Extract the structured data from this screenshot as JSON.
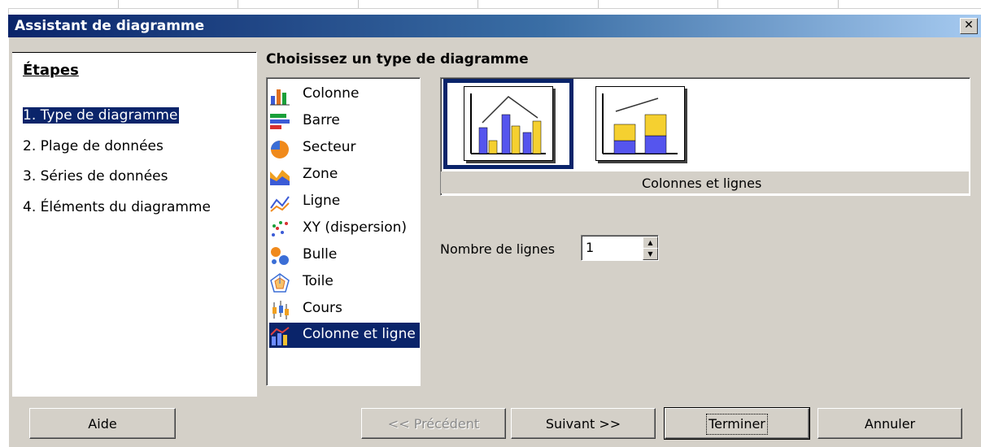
{
  "dialog": {
    "title": "Assistant de diagramme",
    "close_label": "✕"
  },
  "steps": {
    "title": "Étapes",
    "items": [
      {
        "label": "1. Type de diagramme",
        "active": true
      },
      {
        "label": "2. Plage de données"
      },
      {
        "label": "3. Séries de données"
      },
      {
        "label": "4. Éléments du diagramme"
      }
    ]
  },
  "main": {
    "section_title": "Choisissez un type de diagramme",
    "chart_types": [
      {
        "label": "Colonne",
        "icon": "column-chart-icon"
      },
      {
        "label": "Barre",
        "icon": "bar-chart-icon"
      },
      {
        "label": "Secteur",
        "icon": "pie-chart-icon"
      },
      {
        "label": "Zone",
        "icon": "area-chart-icon"
      },
      {
        "label": "Ligne",
        "icon": "line-chart-icon"
      },
      {
        "label": "XY (dispersion)",
        "icon": "scatter-chart-icon"
      },
      {
        "label": "Bulle",
        "icon": "bubble-chart-icon"
      },
      {
        "label": "Toile",
        "icon": "net-chart-icon"
      },
      {
        "label": "Cours",
        "icon": "stock-chart-icon"
      },
      {
        "label": "Colonne et ligne",
        "icon": "column-line-chart-icon",
        "selected": true
      }
    ],
    "variant_caption": "Colonnes et lignes",
    "lines_label": "Nombre de lignes",
    "lines_value": "1"
  },
  "buttons": {
    "help": "Aide",
    "previous": "<< Précédent",
    "next": "Suivant >>",
    "finish": "Terminer",
    "cancel": "Annuler"
  },
  "colors": {
    "title_gradient_start": "#0a246a",
    "selection": "#0a246a",
    "dialog_face": "#d4d0c8"
  }
}
